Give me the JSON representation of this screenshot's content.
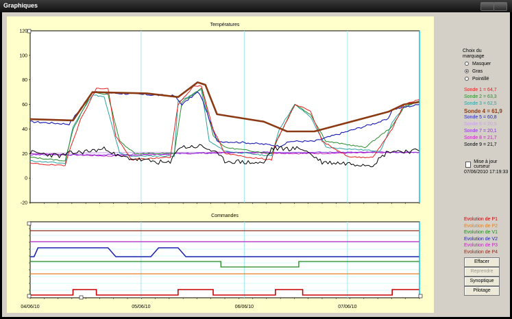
{
  "window": {
    "title": "Graphiques"
  },
  "chart_top": {
    "title": "Températures",
    "y_ticks": [
      "120",
      "100",
      "80",
      "60",
      "40",
      "20",
      "0",
      "-20"
    ],
    "ylim": [
      -20,
      120
    ]
  },
  "chart_bottom": {
    "title": "Commandes",
    "x_ticks": [
      "04/06/10",
      "05/06/10",
      "06/06/10",
      "07/06/10"
    ]
  },
  "colors": {
    "s1": "#e31e1e",
    "s2": "#2a8a2a",
    "s3": "#2aa0a0",
    "s4": "#8b3a14",
    "s5": "#2424b4",
    "s6": "#c8a0e6",
    "s7": "#8a2be2",
    "s8": "#c21ec2",
    "s9": "#000000",
    "p1": "#cc0000",
    "p2": "#e08020",
    "v1": "#1a8a1a",
    "v2": "#2020b0",
    "p3": "#c020c0",
    "p4": "#8b2a1a"
  },
  "panel": {
    "choice_title": "Choix du marquage",
    "options": [
      {
        "label": "Masquer",
        "selected": false
      },
      {
        "label": "Gras",
        "selected": true
      },
      {
        "label": "Pointillé",
        "selected": false
      }
    ],
    "sondes": [
      {
        "label": "Sonde 1 = 64,7",
        "color": "#e31e1e",
        "bold": false
      },
      {
        "label": "Sonde 2 = 63,3",
        "color": "#2a8a2a",
        "bold": false
      },
      {
        "label": "Sonde 3 = 62,5",
        "color": "#2aa0a0",
        "bold": false
      },
      {
        "label": "Sonde 4 = 61,9",
        "color": "#8b3a14",
        "bold": true
      },
      {
        "label": "Sonde 5 = 60,8",
        "color": "#2424b4",
        "bold": false
      },
      {
        "label": "Sonde 6 = 20,5",
        "color": "#c8a0e6",
        "bold": false
      },
      {
        "label": "Sonde 7 = 20,1",
        "color": "#8a2be2",
        "bold": false
      },
      {
        "label": "Sonde 8 = 21,7",
        "color": "#c21ec2",
        "bold": false
      },
      {
        "label": "Sonde 9 = 21,7",
        "color": "#000000",
        "bold": false
      }
    ],
    "checkbox_label": "Mise à jour curseur",
    "timestamp": "07/06/2010 17:19:33",
    "evolutions": [
      {
        "label": "Evolution de P1",
        "color": "#cc0000"
      },
      {
        "label": "Evolution de P2",
        "color": "#e08020"
      },
      {
        "label": "Evolution de V1",
        "color": "#1a8a1a"
      },
      {
        "label": "Evolution de V2",
        "color": "#2020b0"
      },
      {
        "label": "Evolution de P3",
        "color": "#c020c0"
      },
      {
        "label": "Evolution de P4",
        "color": "#8b2a1a"
      }
    ],
    "buttons": [
      {
        "label": "Effacer",
        "enabled": true
      },
      {
        "label": "Reprendre",
        "enabled": false
      },
      {
        "label": "Synoptique",
        "enabled": true
      },
      {
        "label": "Pilotage",
        "enabled": true
      }
    ]
  }
}
